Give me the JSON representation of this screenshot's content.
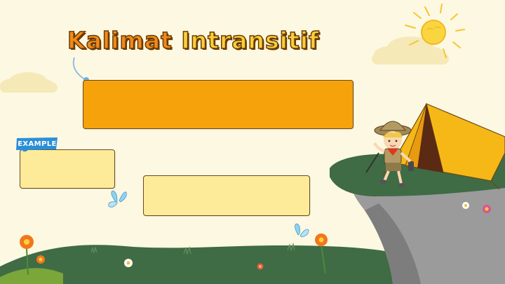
{
  "slide": {
    "title_word1": "Kalimat",
    "title_word2": "Intransitif",
    "example_tag": "EXAMPLE"
  },
  "colors": {
    "background": "#fdf8e1",
    "title_orange": "#f08a1c",
    "title_yellow": "#f9cf3a",
    "main_box": "#f6a20b",
    "light_box": "#fdeb9a",
    "tag_blue": "#2b8fd8",
    "grass": "#3f6b45",
    "tent": "#f6b817"
  },
  "icons": [
    "sun-icon",
    "cloud-icon",
    "butterfly-icon",
    "flower-icon",
    "tent-icon",
    "scout-character-icon"
  ]
}
